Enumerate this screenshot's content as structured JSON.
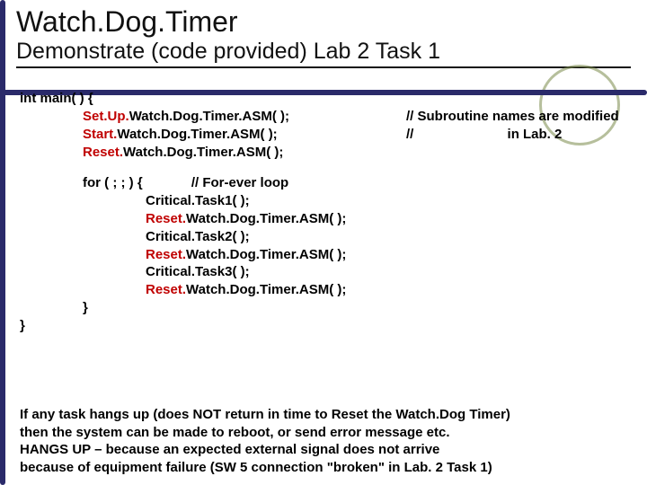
{
  "title": "Watch.Dog.Timer",
  "subtitle": "Demonstrate (code provided) Lab 2 Task 1",
  "code": {
    "l1": "int main( ) {",
    "l2a": "Set.Up.",
    "l2b": "Watch.Dog.Timer.ASM( );",
    "l2c": "// Subroutine names are modified",
    "l3a": "Start.",
    "l3b": "Watch.Dog.Timer.ASM( );",
    "l3c": "//                         in Lab. 2",
    "l4a": "Reset.",
    "l4b": "Watch.Dog.Timer.ASM( );",
    "l5a": "for ( ; ; ) {",
    "l5b": "// For-ever loop",
    "l6": "Critical.Task1( );",
    "l7a": "Reset.",
    "l7b": "Watch.Dog.Timer.ASM( );",
    "l8": "Critical.Task2( );",
    "l9a": "Reset.",
    "l9b": "Watch.Dog.Timer.ASM( );",
    "l10": "Critical.Task3( );",
    "l11a": "Reset.",
    "l11b": "Watch.Dog.Timer.ASM( );",
    "l12": "}",
    "l13": "}"
  },
  "footer": {
    "f1": "If any task hangs up (does NOT return in time to Reset the Watch.Dog Timer)",
    "f2": "      then the system can be made to reboot, or send error message etc.",
    "f3": "HANGS UP – because an expected external signal does not arrive",
    "f4": "because of equipment failure (SW 5 connection \"broken\" in Lab. 2 Task 1)"
  }
}
